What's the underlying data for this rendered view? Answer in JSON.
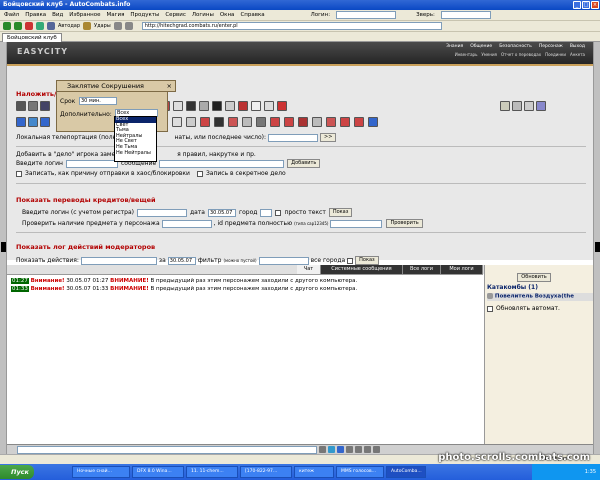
{
  "window": {
    "title": "Бойцовский клуб - AutoCombats.info"
  },
  "menu": [
    "Файл",
    "Правка",
    "Вид",
    "Избранное",
    "Магия",
    "Продукты",
    "Сервис",
    "Логины",
    "Окна",
    "Справка"
  ],
  "menu_fields": {
    "login_label": "Логин:",
    "beast_label": "Зверь:"
  },
  "toolbar": {
    "autodef": "Автодар",
    "runes": "Удары",
    "address": "http://hitechgrad.combats.ru/enter.pl"
  },
  "browser_tab": "Бойцовский клуб",
  "game": {
    "logo": "EASYCITY",
    "nav": [
      "Знания",
      "Общение",
      "Безопасность",
      "Персонаж",
      "Выход"
    ],
    "subnav": [
      "Инвентарь",
      "Умения",
      "Отчет о переводах",
      "Поединки",
      "Анкета"
    ]
  },
  "dialog": {
    "title": "Заклятие Сокрушения",
    "term_label": "Срок",
    "term_value": "30 мин.",
    "extra_label": "Дополнительно:",
    "extra_value": "Всех",
    "options": [
      "Всех",
      "Свет",
      "Тьма",
      "Нейтралы",
      "Не Свет",
      "Не Тьма",
      "Не Нейтралы"
    ]
  },
  "section_impose": "Наложить/с",
  "teleport": {
    "label": "Локальная телепортация (полн",
    "label2": "наты, или последнее число):",
    "go": ">>"
  },
  "jail": {
    "line1_a": "Добавить в \"дело\" игрока заме",
    "line1_b": "я правил, накрутке и пр.",
    "login_label": "Введите логин",
    "msg_label": "сообщение",
    "add_button": "Добавить",
    "chk_chaos": "Записать, как причину отправки в хаос/блокировки",
    "chk_secret": "Запись в секретное дело"
  },
  "transfers": {
    "title": "Показать переводы кредитов/вещей",
    "login_label": "Введите логин (с учетом регистра)",
    "date_label": "дата",
    "date_value": "30.05.07",
    "city_label": "город",
    "plain_text": "просто текст",
    "show": "Показ",
    "item_check_label": "Проверить наличие предмета у персонажа",
    "item_id_label": ", id предмета полностью",
    "item_id_hint": "(типа cap12345)",
    "check_button": "Проверить"
  },
  "moder_logs": {
    "title": "Показать лог действий модераторов",
    "actions_label": "Показать действия:",
    "for_label": "за",
    "date_value": "30.05.07",
    "filter_label": "фильтр",
    "filter_hint": "(можно пустой)",
    "all_cities": "все города",
    "show": "Показ"
  },
  "chat_tabs": [
    "Чат",
    "Системные сообщения",
    "Все логи",
    "Мои логи"
  ],
  "chat_lines": [
    {
      "time": "01:27",
      "warn_prefix": "Внимание!",
      "stamp": "30.05.07 01:27",
      "warn": "ВНИМАНИЕ!",
      "text": "В предыдущий раз этим персонажем заходили с другого компьютера."
    },
    {
      "time": "01:33",
      "warn_prefix": "Внимание!",
      "stamp": "30.05.07 01:33",
      "warn": "ВНИМАНИЕ!",
      "text": "В предыдущий раз этим персонажем заходили с другого компьютера."
    }
  ],
  "right_panel": {
    "refresh": "Обновить",
    "location": "Катакомбы (1)",
    "player": "Повелитель Воздуха(the",
    "auto_refresh": "Обновлять автомат."
  },
  "statusbar": {
    "left": "",
    "right": "Интернет"
  },
  "taskbar": {
    "start": "Пуск",
    "tasks": [
      "Ночные снай...",
      "DFX 8.0 Wina...",
      "11. 11-chem...",
      "[170-822-97...",
      "китеж",
      "MMS голосов...",
      "AutoComba..."
    ],
    "clock": "1:35"
  },
  "watermark": "photo.scrolls.combats.com"
}
